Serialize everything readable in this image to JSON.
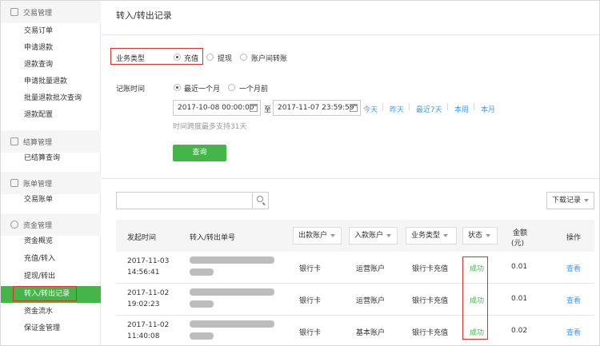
{
  "sidebar": {
    "sections": [
      {
        "title": "交易管理",
        "icon": "transaction-icon",
        "items": [
          "交易订单",
          "申请退款",
          "退款查询",
          "申请批量退款",
          "批量退款批次查询",
          "退款配置"
        ]
      },
      {
        "title": "结算管理",
        "icon": "settlement-icon",
        "items": [
          "已结算查询"
        ]
      },
      {
        "title": "账单管理",
        "icon": "bill-icon",
        "items": [
          "交易账单"
        ]
      },
      {
        "title": "资金管理",
        "icon": "fund-icon",
        "items": [
          "资金概览",
          "充值/转入",
          "提现/转出",
          "转入/转出记录",
          "资金流水",
          "保证金管理"
        ]
      }
    ]
  },
  "main": {
    "title": "转入/转出记录",
    "filter": {
      "business_type_label": "业务类型",
      "business_types": [
        "充值",
        "提现",
        "账户间转账"
      ],
      "selected_type": "充值",
      "time_label": "记账时间",
      "time_ranges": [
        "最近一个月",
        "一个月前"
      ],
      "start_time": "2017-10-08 00:00:00",
      "to_label": "至",
      "end_time": "2017-11-07 23:59:59",
      "quick_ranges": [
        "今天",
        "昨天",
        "最近7天",
        "本周",
        "本月"
      ],
      "hint": "时间跨度最多支持31天",
      "query_button": "查询"
    },
    "search": {
      "placeholder": ""
    },
    "download_button": "下载记录",
    "table": {
      "headers": {
        "time": "发起时间",
        "order_no": "转入/转出单号",
        "out_account": "出款账户",
        "in_account": "入款账户",
        "biz_type": "业务类型",
        "status": "状态",
        "amount_line1": "金额",
        "amount_line2": "(元)",
        "action": "操作"
      },
      "rows": [
        {
          "date": "2017-11-03",
          "time": "14:56:41",
          "out_account": "银行卡",
          "in_account": "运营账户",
          "biz_type": "银行卡充值",
          "status": "成功",
          "amount": "0.01",
          "action": "查看"
        },
        {
          "date": "2017-11-02",
          "time": "19:02:23",
          "out_account": "银行卡",
          "in_account": "运营账户",
          "biz_type": "银行卡充值",
          "status": "成功",
          "amount": "0.01",
          "action": "查看"
        },
        {
          "date": "2017-11-02",
          "time": "11:40:08",
          "out_account": "银行卡",
          "in_account": "基本账户",
          "biz_type": "银行卡充值",
          "status": "成功",
          "amount": "0.02",
          "action": "查看"
        }
      ]
    }
  },
  "colors": {
    "accent": "#44b549",
    "link": "#459ae9",
    "highlight": "#d9312f"
  }
}
